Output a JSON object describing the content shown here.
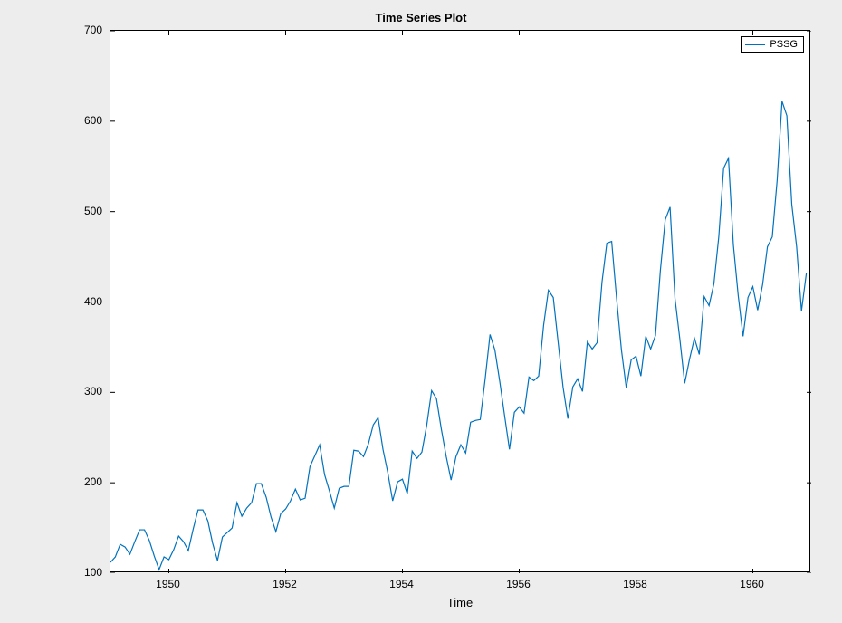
{
  "chart_data": {
    "type": "line",
    "title": "Time Series Plot",
    "xlabel": "Time",
    "ylabel": "",
    "xlim": [
      1949,
      1961
    ],
    "ylim": [
      100,
      700
    ],
    "xticks": [
      1950,
      1952,
      1954,
      1956,
      1958,
      1960
    ],
    "yticks": [
      100,
      200,
      300,
      400,
      500,
      600,
      700
    ],
    "legend_position": "northeast",
    "series": [
      {
        "name": "PSSG",
        "color": "#0072bd",
        "x": [
          1949.0,
          1949.083,
          1949.167,
          1949.25,
          1949.333,
          1949.417,
          1949.5,
          1949.583,
          1949.667,
          1949.75,
          1949.833,
          1949.917,
          1950.0,
          1950.083,
          1950.167,
          1950.25,
          1950.333,
          1950.417,
          1950.5,
          1950.583,
          1950.667,
          1950.75,
          1950.833,
          1950.917,
          1951.0,
          1951.083,
          1951.167,
          1951.25,
          1951.333,
          1951.417,
          1951.5,
          1951.583,
          1951.667,
          1951.75,
          1951.833,
          1951.917,
          1952.0,
          1952.083,
          1952.167,
          1952.25,
          1952.333,
          1952.417,
          1952.5,
          1952.583,
          1952.667,
          1952.75,
          1952.833,
          1952.917,
          1953.0,
          1953.083,
          1953.167,
          1953.25,
          1953.333,
          1953.417,
          1953.5,
          1953.583,
          1953.667,
          1953.75,
          1953.833,
          1953.917,
          1954.0,
          1954.083,
          1954.167,
          1954.25,
          1954.333,
          1954.417,
          1954.5,
          1954.583,
          1954.667,
          1954.75,
          1954.833,
          1954.917,
          1955.0,
          1955.083,
          1955.167,
          1955.25,
          1955.333,
          1955.417,
          1955.5,
          1955.583,
          1955.667,
          1955.75,
          1955.833,
          1955.917,
          1956.0,
          1956.083,
          1956.167,
          1956.25,
          1956.333,
          1956.417,
          1956.5,
          1956.583,
          1956.667,
          1956.75,
          1956.833,
          1956.917,
          1957.0,
          1957.083,
          1957.167,
          1957.25,
          1957.333,
          1957.417,
          1957.5,
          1957.583,
          1957.667,
          1957.75,
          1957.833,
          1957.917,
          1958.0,
          1958.083,
          1958.167,
          1958.25,
          1958.333,
          1958.417,
          1958.5,
          1958.583,
          1958.667,
          1958.75,
          1958.833,
          1958.917,
          1959.0,
          1959.083,
          1959.167,
          1959.25,
          1959.333,
          1959.417,
          1959.5,
          1959.583,
          1959.667,
          1959.75,
          1959.833,
          1959.917,
          1960.0,
          1960.083,
          1960.167,
          1960.25,
          1960.333,
          1960.417,
          1960.5,
          1960.583,
          1960.667,
          1960.75,
          1960.833,
          1960.917
        ],
        "values": [
          112,
          118,
          132,
          129,
          121,
          135,
          148,
          148,
          136,
          119,
          104,
          118,
          115,
          126,
          141,
          135,
          125,
          149,
          170,
          170,
          158,
          133,
          114,
          140,
          145,
          150,
          178,
          163,
          172,
          178,
          199,
          199,
          184,
          162,
          146,
          166,
          171,
          180,
          193,
          181,
          183,
          218,
          230,
          242,
          209,
          191,
          172,
          194,
          196,
          196,
          236,
          235,
          229,
          243,
          264,
          272,
          237,
          211,
          180,
          201,
          204,
          188,
          235,
          227,
          234,
          264,
          302,
          293,
          259,
          229,
          203,
          229,
          242,
          233,
          267,
          269,
          270,
          315,
          364,
          347,
          312,
          274,
          237,
          278,
          284,
          277,
          317,
          313,
          318,
          374,
          413,
          405,
          355,
          306,
          271,
          306,
          315,
          301,
          356,
          348,
          355,
          422,
          465,
          467,
          404,
          347,
          305,
          336,
          340,
          318,
          362,
          348,
          363,
          435,
          491,
          505,
          404,
          359,
          310,
          337,
          360,
          342,
          406,
          396,
          420,
          472,
          548,
          559,
          463,
          407,
          362,
          405,
          417,
          391,
          419,
          461,
          472,
          535,
          622,
          606,
          508,
          461,
          390,
          432
        ]
      }
    ]
  }
}
